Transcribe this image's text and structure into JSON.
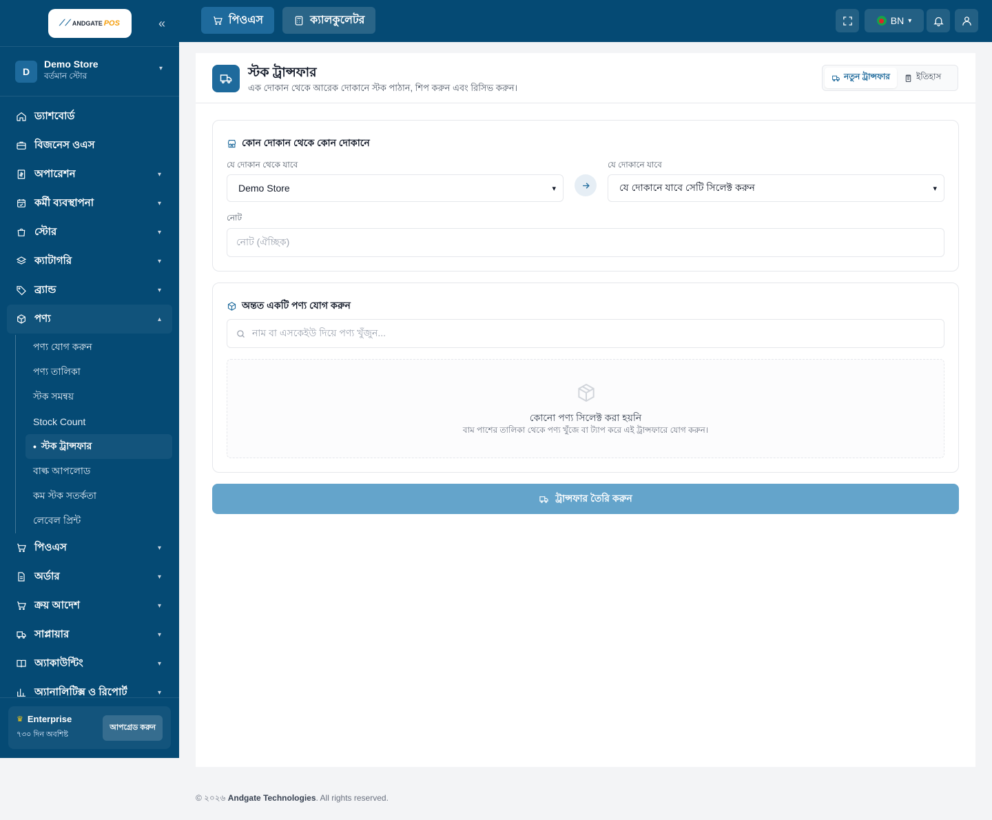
{
  "brand": {
    "logo_text": "ANDGATE",
    "logo_accent": "POS"
  },
  "store": {
    "initial": "D",
    "name": "Demo Store",
    "subtitle": "বর্তমান স্টোর"
  },
  "sidebar": {
    "items": [
      {
        "label": "ড্যাশবোর্ড",
        "icon": "home-icon"
      },
      {
        "label": "বিজনেস ওএস",
        "icon": "briefcase-icon"
      },
      {
        "label": "অপারেশন",
        "icon": "receipt-icon"
      },
      {
        "label": "কর্মী ব্যবস্থাপনা",
        "icon": "calendar-icon"
      },
      {
        "label": "স্টোর",
        "icon": "bag-icon"
      },
      {
        "label": "ক্যাটাগরি",
        "icon": "layers-icon"
      },
      {
        "label": "ব্র্যান্ড",
        "icon": "tag-icon"
      },
      {
        "label": "পণ্য",
        "icon": "box-icon"
      }
    ],
    "sub_items": [
      "পণ্য যোগ করুন",
      "পণ্য তালিকা",
      "স্টক সমন্বয়",
      "Stock Count",
      "স্টক ট্রান্সফার",
      "বাল্ক আপলোড",
      "কম স্টক সতর্কতা",
      "লেবেল প্রিন্ট"
    ],
    "items_after": [
      {
        "label": "পিওএস",
        "icon": "cart-icon"
      },
      {
        "label": "অর্ডার",
        "icon": "document-icon"
      },
      {
        "label": "ক্রয় আদেশ",
        "icon": "cart-icon"
      },
      {
        "label": "সাপ্লায়ার",
        "icon": "truck-icon"
      },
      {
        "label": "অ্যাকাউন্টিং",
        "icon": "book-icon"
      },
      {
        "label": "অ্যানালিটিক্স ও রিপোর্ট",
        "icon": "chart-icon"
      }
    ],
    "plan": {
      "name": "Enterprise",
      "days": "৭৩০ দিন অবশিষ্ট",
      "upgrade": "আপগ্রেড করুন"
    }
  },
  "topbar": {
    "pos_tab": "পিওএস",
    "calc_tab": "ক্যালকুলেটর",
    "lang": "BN"
  },
  "page": {
    "title": "স্টক ট্রান্সফার",
    "subtitle": "এক দোকান থেকে আরেক দোকানে স্টক পাঠান, শিপ করুন এবং রিসিভ করুন।",
    "tab_new": "নতুন ট্রান্সফার",
    "tab_history": "ইতিহাস"
  },
  "route_panel": {
    "title": "কোন দোকান থেকে কোন দোকানে",
    "from_label": "যে দোকান থেকে যাবে",
    "from_value": "Demo Store",
    "to_label": "যে দোকানে যাবে",
    "to_value": "যে দোকানে যাবে সেটি সিলেক্ট করুন",
    "note_label": "নোট",
    "note_placeholder": "নোট (ঐচ্ছিক)"
  },
  "product_panel": {
    "title": "অন্তত একটি পণ্য যোগ করুন",
    "search_placeholder": "নাম বা এসকেইউ দিয়ে পণ্য খুঁজুন...",
    "empty_title": "কোনো পণ্য সিলেক্ট করা হয়নি",
    "empty_sub": "বাম পাশের তালিকা থেকে পণ্য খুঁজে বা ট্যাপ করে এই ট্রান্সফারে যোগ করুন।"
  },
  "create_button": "ট্রান্সফার তৈরি করুন",
  "footer": {
    "prefix": "© ২০২৬ ",
    "company": "Andgate Technologies",
    "suffix": ". All rights reserved."
  },
  "colors": {
    "sidebar_bg": "#054a74",
    "accent": "#1e6a9c",
    "button_bg": "#64a4cb"
  }
}
